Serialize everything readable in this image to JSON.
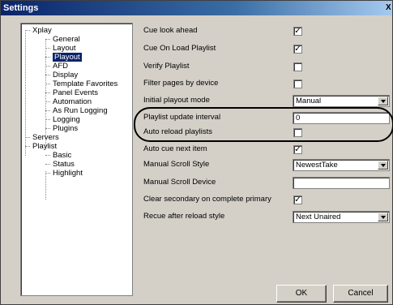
{
  "window": {
    "title": "Settings",
    "close_glyph": "X"
  },
  "tree": {
    "xplay": "Xplay",
    "general": "General",
    "layout": "Layout",
    "playout": "Playout",
    "afd": "AFD",
    "display": "Display",
    "template_favorites": "Template Favorites",
    "panel_events": "Panel Events",
    "automation": "Automation",
    "as_run_logging": "As Run Logging",
    "logging": "Logging",
    "plugins": "Plugins",
    "servers": "Servers",
    "playlist": "Playlist",
    "basic": "Basic",
    "status": "Status",
    "highlight": "Highlight"
  },
  "settings": {
    "cue_look_ahead": {
      "label": "Cue look ahead",
      "checked": true,
      "mark": "✓"
    },
    "cue_on_load_playlist": {
      "label": "Cue On Load Playlist",
      "checked": true,
      "mark": "✓"
    },
    "verify_playlist": {
      "label": "Verify Playlist",
      "checked": false,
      "mark": ""
    },
    "filter_pages_by_device": {
      "label": "Filter pages by device",
      "checked": false,
      "mark": ""
    },
    "initial_playout_mode": {
      "label": "Initial playout mode",
      "value": "Manual"
    },
    "playlist_update_interval": {
      "label": "Playlist update interval",
      "value": "0"
    },
    "auto_reload_playlists": {
      "label": "Auto reload playlists",
      "checked": false,
      "mark": ""
    },
    "auto_cue_next_item": {
      "label": "Auto cue next item",
      "checked": true,
      "mark": "✓"
    },
    "manual_scroll_style": {
      "label": "Manual Scroll Style",
      "value": "NewestTake"
    },
    "manual_scroll_device": {
      "label": "Manual Scroll Device",
      "value": ""
    },
    "clear_secondary": {
      "label": "Clear secondary on complete primary",
      "checked": true,
      "mark": "✓"
    },
    "recue_after_reload_style": {
      "label": "Recue after reload style",
      "value": "Next Unaired"
    }
  },
  "buttons": {
    "ok": "OK",
    "cancel": "Cancel"
  },
  "colors": {
    "title_bar": "#0a246a",
    "selection": "#0a246a",
    "dialog_bg": "#d4d0c8"
  }
}
